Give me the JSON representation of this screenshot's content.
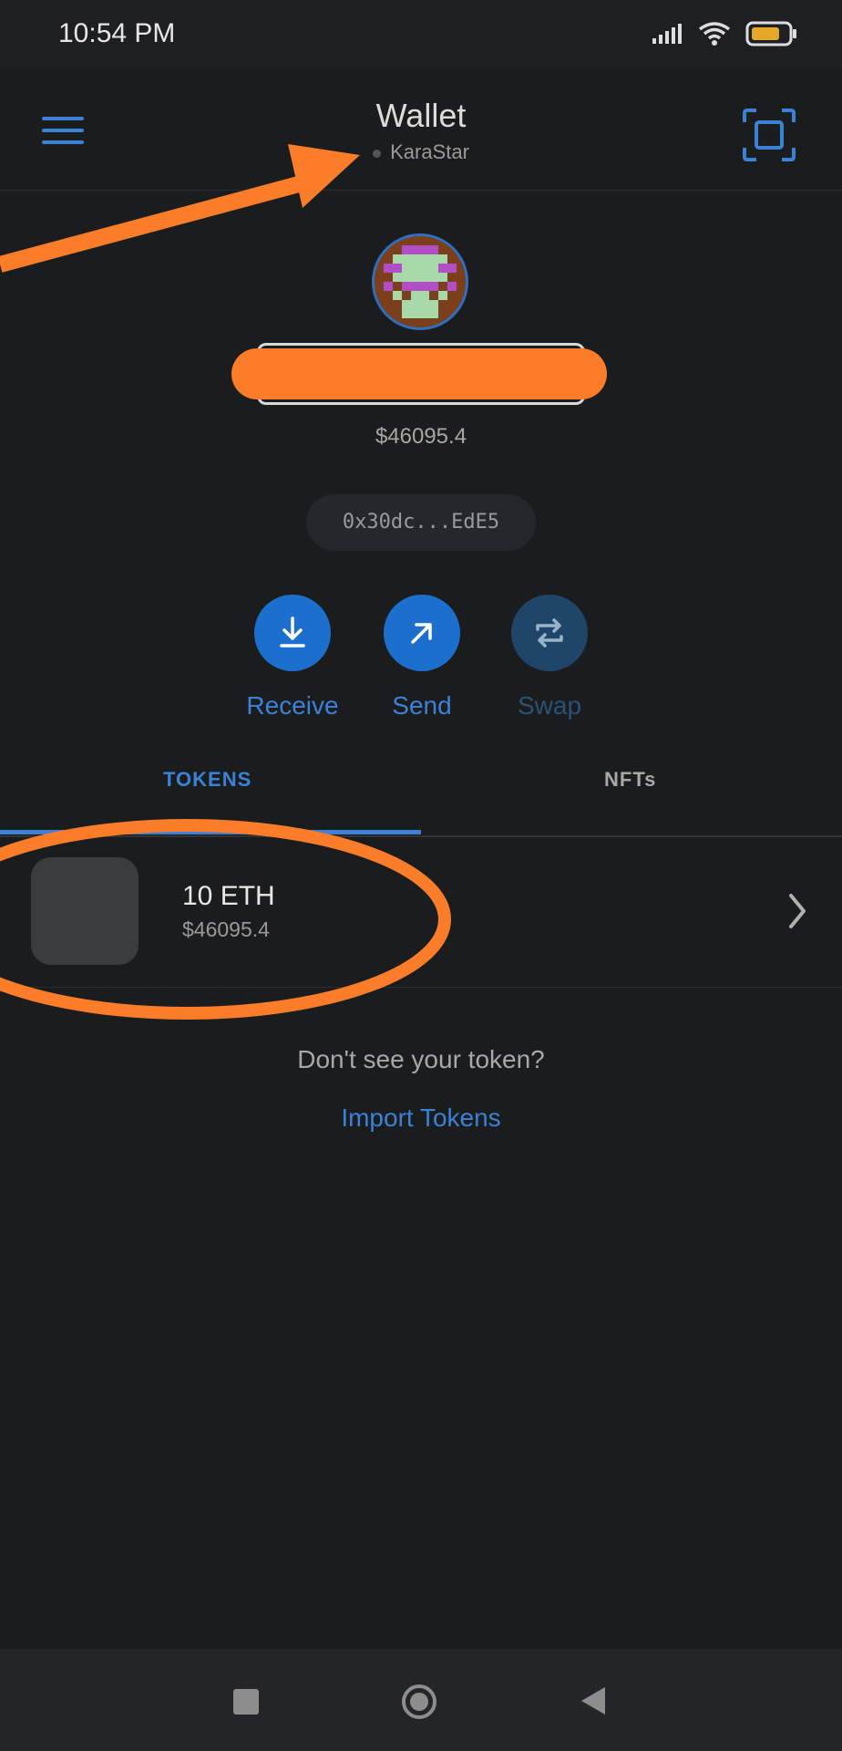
{
  "status_bar": {
    "time": "10:54 PM",
    "icons": [
      "signal-icon",
      "wifi-icon",
      "battery-icon"
    ]
  },
  "header": {
    "title": "Wallet",
    "network": "KaraStar",
    "icons": [
      "menu-icon",
      "scan-icon"
    ]
  },
  "account": {
    "balance": "$46095.4",
    "address": "0x30dc...EdE5"
  },
  "actions": [
    {
      "label": "Receive",
      "icon": "download-icon"
    },
    {
      "label": "Send",
      "icon": "send-arrow-icon"
    },
    {
      "label": "Swap",
      "icon": "swap-icon"
    }
  ],
  "tabs": [
    {
      "label": "TOKENS",
      "active": true
    },
    {
      "label": "NFTs",
      "active": false
    }
  ],
  "tokens": [
    {
      "amount": "10 ETH",
      "value": "$46095.4"
    }
  ],
  "footer": {
    "prompt": "Don't see your token?",
    "import_label": "Import Tokens"
  },
  "colors": {
    "accent": "#3b82d6",
    "background": "#1b1c1e",
    "annotation": "#fb7d2a"
  }
}
